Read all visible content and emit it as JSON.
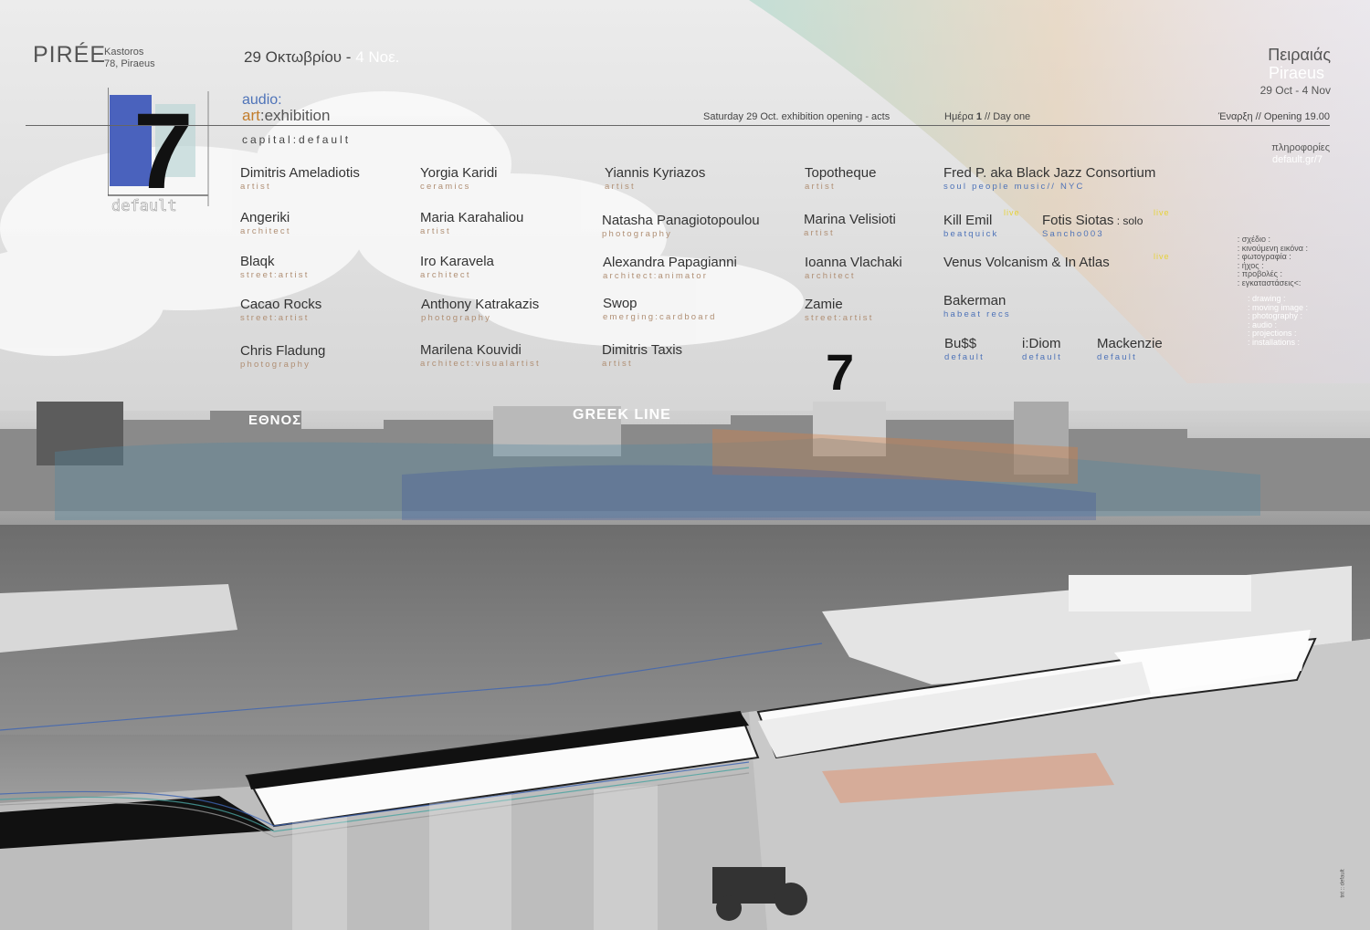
{
  "header": {
    "venue": "PIRÉE",
    "address": [
      "Kastoros",
      "78, Piraeus"
    ],
    "date_greek_a": "29 Οκτωβρίου - ",
    "date_greek_b": "4 Νοε.",
    "city_greek": "Πειραιάς",
    "city_english": "Piraeus",
    "city_dates": "29 Oct - 4 Nov"
  },
  "logo": {
    "number": "7",
    "word": "default"
  },
  "section": {
    "audio": "audio:",
    "art_word": "art",
    "exhibition_word": ":exhibition",
    "subtitle": "capital:default",
    "saturday_line": "Saturday 29 Oct. exhibition opening - acts",
    "day_label_a": "Ημέρα ",
    "day_label_num": "1",
    "day_label_b": " // Day one",
    "opening": "Έναρξη // Opening 19.00",
    "info_greek": "πληροφορίες",
    "info_url": "default.gr/7"
  },
  "artists": [
    {
      "name": "Dimitris Ameladiotis",
      "role": "artist"
    },
    {
      "name": "Angeriki",
      "role": "architect"
    },
    {
      "name": "Blaqk",
      "role": "street:artist"
    },
    {
      "name": "Cacao Rocks",
      "role": "street:artist"
    },
    {
      "name": "Chris Fladung",
      "role": "photography"
    },
    {
      "name": "Yorgia Karidi",
      "role": "ceramics"
    },
    {
      "name": "Maria Karahaliou",
      "role": "artist"
    },
    {
      "name": "Iro Karavela",
      "role": "architect"
    },
    {
      "name": "Anthony Katrakazis",
      "role": "photography"
    },
    {
      "name": "Marilena Kouvidi",
      "role": "architect:visualartist"
    },
    {
      "name": "Yiannis Kyriazos",
      "role": "artist"
    },
    {
      "name": "Natasha Panagiotopoulou",
      "role": "photography"
    },
    {
      "name": "Alexandra Papagianni",
      "role": "architect:animator"
    },
    {
      "name": "Swop",
      "role": "emerging:cardboard"
    },
    {
      "name": "Dimitris Taxis",
      "role": "artist"
    },
    {
      "name": "Topotheque",
      "role": "artist"
    },
    {
      "name": "Marina Velisioti",
      "role": "artist"
    },
    {
      "name": "Ioanna Vlachaki",
      "role": "architect"
    },
    {
      "name": "Zamie",
      "role": "street:artist"
    }
  ],
  "acts": {
    "fred": {
      "name": "Fred P. aka Black Jazz Consortium",
      "role": "soul people music// NYC"
    },
    "kill": {
      "name": "Kill Emil",
      "role": "beatquick",
      "live": "live"
    },
    "fotis": {
      "name": "Fotis Siotas",
      "suffix": " : solo",
      "role": "Sancho003",
      "live": "live"
    },
    "venus": {
      "name": "Venus Volcanism & In Atlas",
      "live": "live"
    },
    "bakerman": {
      "name": "Bakerman",
      "role": "habeat recs"
    },
    "buss": {
      "name": "Bu$$",
      "role": "default"
    },
    "idiom": {
      "name": "i:Diom",
      "role": "default"
    },
    "mackenzie": {
      "name": "Mackenzie",
      "role": "default"
    }
  },
  "legend_greek": [
    ": σχέδιο :",
    ": κινούμενη εικόνα :",
    ": φωτογραφία :",
    ": ήχος :",
    ": προβολές :",
    ": εγκαταστάσεις<:"
  ],
  "legend_english": [
    ": drawing :",
    ": moving image :",
    ": photography :",
    ": audio :",
    ": projections :",
    ": installations :"
  ],
  "photo_signs": {
    "ethnos": "ΕΘΝΟΣ",
    "greek_line": "GREEK LINE",
    "big_seven": "7"
  },
  "credit": "tnt :: default",
  "colors": {
    "blue": "#4e73b8",
    "orange": "#c27c2b",
    "live_yellow": "#e6d23a",
    "role_tan": "#b08f74"
  }
}
